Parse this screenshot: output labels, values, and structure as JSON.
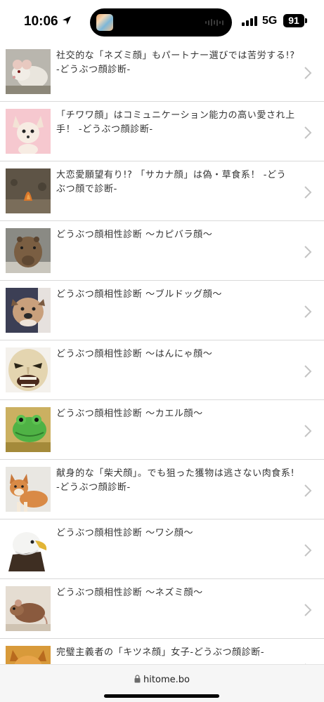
{
  "status_bar": {
    "time": "10:06",
    "network": "5G",
    "battery": "91"
  },
  "articles": [
    {
      "title": "社交的な「ネズミ顔」もパートナー選びでは苦労する!? -どうぶつ顔診断-",
      "thumb": "rat-icon"
    },
    {
      "title": "「チワワ顔」はコミュニケーション能力の高い愛され上手！ -どうぶつ顔診断-",
      "thumb": "chihuahua-icon"
    },
    {
      "title": "大恋愛願望有り!? 「サカナ顔」は偽・草食系！ -どうぶつ顔で診断-",
      "thumb": "fish-icon"
    },
    {
      "title": "どうぶつ顔相性診断 〜カピバラ顔〜",
      "thumb": "capybara-icon"
    },
    {
      "title": "どうぶつ顔相性診断 〜ブルドッグ顔〜",
      "thumb": "bulldog-icon"
    },
    {
      "title": "どうぶつ顔相性診断 〜はんにゃ顔〜",
      "thumb": "hannya-mask-icon"
    },
    {
      "title": "どうぶつ顔相性診断 〜カエル顔〜",
      "thumb": "frog-icon"
    },
    {
      "title": "献身的な「柴犬顔」。でも狙った獲物は逃さない肉食系! -どうぶつ顔診断-",
      "thumb": "shiba-icon"
    },
    {
      "title": "どうぶつ顔相性診断 〜ワシ顔〜",
      "thumb": "eagle-icon"
    },
    {
      "title": "どうぶつ顔相性診断 〜ネズミ顔〜",
      "thumb": "mouse-icon"
    },
    {
      "title": "完璧主義者の「キツネ顔」女子-どうぶつ顔診断-",
      "thumb": "fox-icon"
    }
  ],
  "url_bar": {
    "domain": "hitome.bo"
  }
}
